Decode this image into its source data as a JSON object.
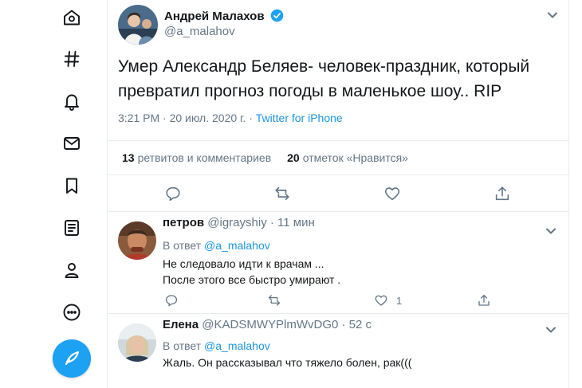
{
  "sidebar": {
    "icons": [
      "home-icon",
      "explore-icon",
      "notifications-icon",
      "messages-icon",
      "bookmarks-icon",
      "lists-icon",
      "profile-icon",
      "more-icon"
    ],
    "compose_icon": "compose-tweet-icon"
  },
  "tweet": {
    "author_name": "Андрей Малахов",
    "author_handle": "@a_malahov",
    "verified": true,
    "text": "Умер Александр Беляев- человек-праздник, который превратил прогноз погоды в маленькое шоу.. RIP",
    "time": "3:21 PM · 20 июл. 2020 г. · ",
    "source": "Twitter for iPhone",
    "retweets_count": "13",
    "retweets_label": "ретвитов и комментариев",
    "likes_count": "20",
    "likes_label": "отметок «Нравится»"
  },
  "replies": [
    {
      "name": "петров",
      "handle": "@igrayshiy",
      "time": " · 11 мин",
      "reply_label": "В ответ ",
      "reply_to": "@a_malahov",
      "text": "Не следовало идти к врачам ...\nПосле этого все быстро умирают .",
      "like_count": "1"
    },
    {
      "name": "Елена",
      "handle": "@KADSMWYPlmWvDG0",
      "time": " · 52 с",
      "reply_label": "В ответ ",
      "reply_to": "@a_malahov",
      "text": "Жаль. Он рассказывал что тяжело болен, рак((("
    }
  ],
  "colors": {
    "accent": "#1da1f2",
    "link": "#1b95e0",
    "muted": "#657786",
    "border": "#e6ecf0"
  }
}
